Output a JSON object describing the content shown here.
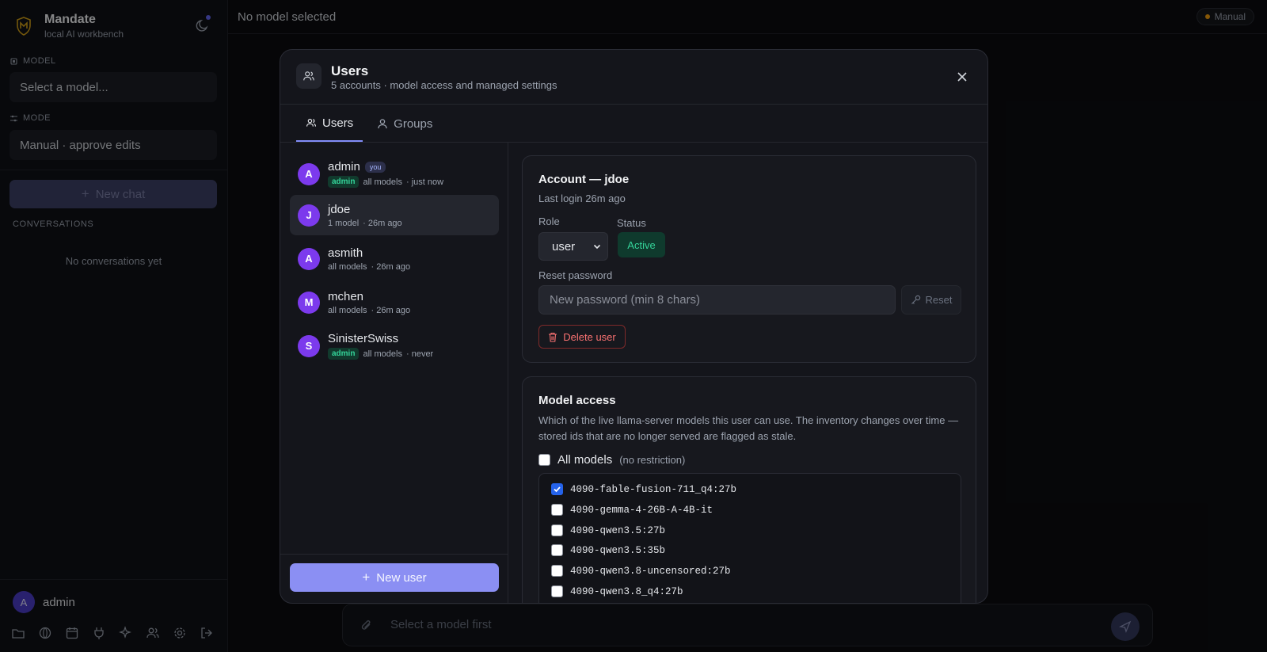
{
  "app": {
    "name": "Mandate",
    "subtitle": "local AI workbench"
  },
  "sidebar": {
    "model_label": "MODEL",
    "model_select": "Select a model...",
    "mode_label": "MODE",
    "mode_select": "Manual · approve edits",
    "new_chat": "New chat",
    "conversations_label": "CONVERSATIONS",
    "conversations_empty": "No conversations yet",
    "user": {
      "initial": "A",
      "name": "admin"
    }
  },
  "header": {
    "title": "No model selected",
    "mode_badge": "Manual"
  },
  "composer": {
    "placeholder": "Select a model first"
  },
  "modal": {
    "title": "Users",
    "subtitle": "5 accounts · model access and managed settings",
    "tabs": [
      {
        "label": "Users"
      },
      {
        "label": "Groups"
      }
    ],
    "users": [
      {
        "initial": "A",
        "name": "admin",
        "you": "you",
        "role_badge": "admin",
        "models": "all models",
        "last": "· just now"
      },
      {
        "initial": "J",
        "name": "jdoe",
        "models": "1 model",
        "last": "· 26m ago"
      },
      {
        "initial": "A",
        "name": "asmith",
        "models": "all models",
        "last": "· 26m ago"
      },
      {
        "initial": "M",
        "name": "mchen",
        "models": "all models",
        "last": "· 26m ago"
      },
      {
        "initial": "S",
        "name": "SinisterSwiss",
        "role_badge": "admin",
        "models": "all models",
        "last": "· never"
      }
    ],
    "new_user": "New user",
    "account": {
      "title": "Account — jdoe",
      "last_login": "Last login 26m ago",
      "role_label": "Role",
      "role_value": "user",
      "status_label": "Status",
      "status_value": "Active",
      "reset_label": "Reset password",
      "password_placeholder": "New password (min 8 chars)",
      "reset_button": "Reset",
      "delete_button": "Delete user"
    },
    "model_access": {
      "title": "Model access",
      "description": "Which of the live llama-server models this user can use. The inventory changes over time — stored ids that are no longer served are flagged as stale.",
      "all_models_label": "All models",
      "all_models_note": "(no restriction)",
      "all_models_checked": false,
      "models": [
        {
          "id": "4090-fable-fusion-711_q4:27b",
          "checked": true
        },
        {
          "id": "4090-gemma-4-26B-A-4B-it",
          "checked": false
        },
        {
          "id": "4090-qwen3.5:27b",
          "checked": false
        },
        {
          "id": "4090-qwen3.5:35b",
          "checked": false
        },
        {
          "id": "4090-qwen3.8-uncensored:27b",
          "checked": false
        },
        {
          "id": "4090-qwen3.8_q4:27b",
          "checked": false
        }
      ]
    }
  },
  "colors": {
    "accent": "#8b8ff3",
    "avatar": "#7c3aed",
    "active": "#34d399",
    "danger": "#f87171"
  }
}
